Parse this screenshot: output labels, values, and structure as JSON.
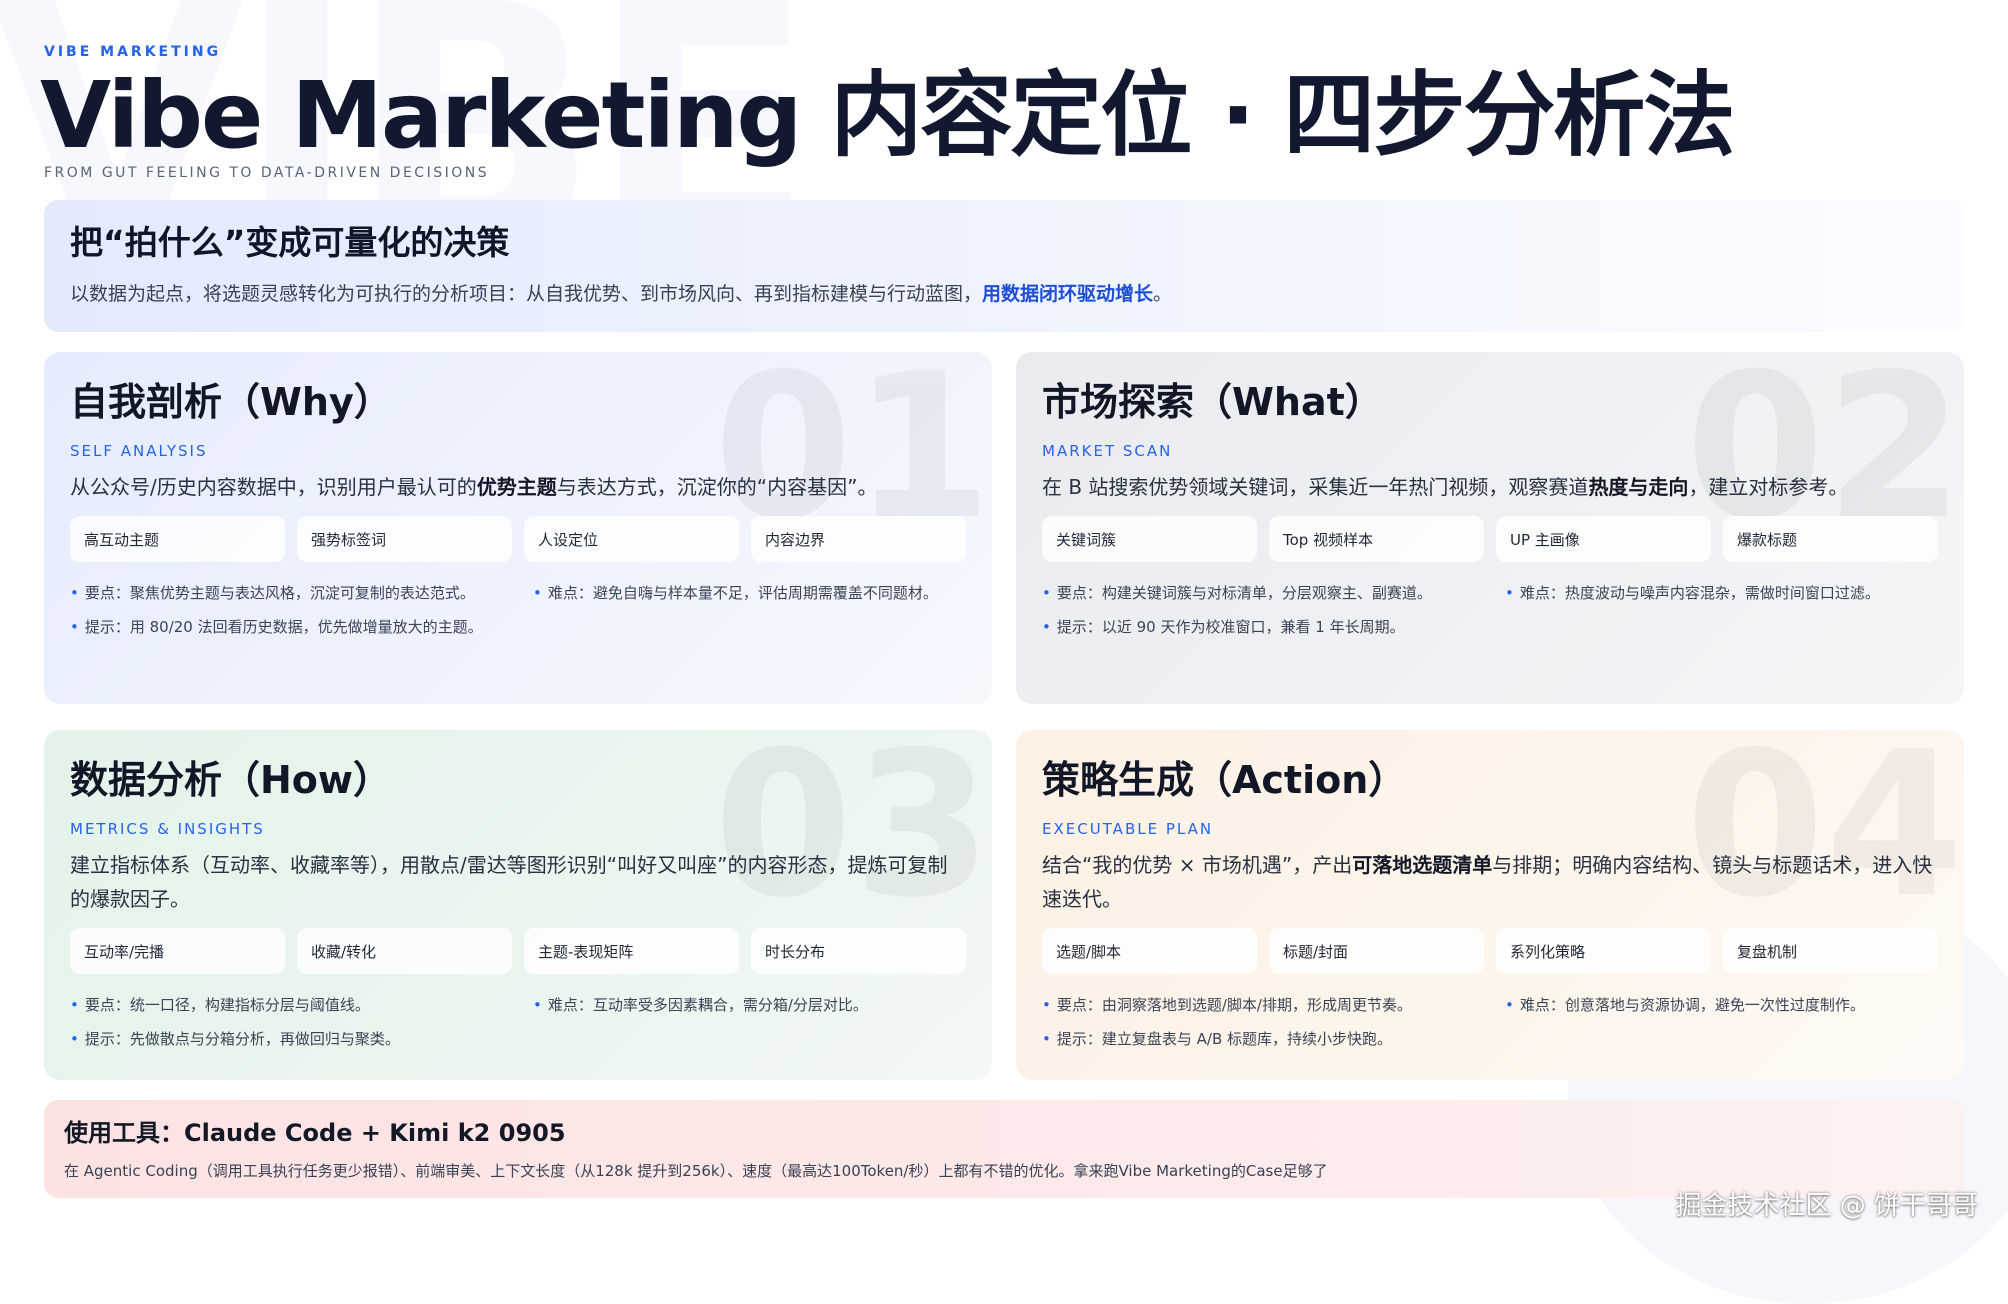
{
  "header": {
    "eyebrow": "VIBE MARKETING",
    "title": "Vibe Marketing 内容定位 · 四步分析法",
    "subtitle": "FROM GUT FEELING TO DATA-DRIVEN DECISIONS"
  },
  "intro": {
    "title": "把“拍什么”变成可量化的决策",
    "desc": "以数据为起点，将选题灵感转化为可执行的分析项目：从自我优势、到市场风向、再到指标建模与行动蓝图，",
    "highlight": "用数据闭环驱动增长",
    "end": "。"
  },
  "cards": [
    {
      "num": "01",
      "title": "自我剖析（Why）",
      "tag": "SELF ANALYSIS",
      "desc_a": "从公众号/历史内容数据中，识别用户最认可的",
      "desc_b": "优势主题",
      "desc_c": "与表达方式，沉淀你的“内容基因”。",
      "chips": [
        "高互动主题",
        "强势标签词",
        "人设定位",
        "内容边界"
      ],
      "notes": [
        "要点：聚焦优势主题与表达风格，沉淀可复制的表达范式。",
        "难点：避免自嗨与样本量不足，评估周期需覆盖不同题材。",
        "提示：用 80/20 法回看历史数据，优先做增量放大的主题。"
      ]
    },
    {
      "num": "02",
      "title": "市场探索（What）",
      "tag": "MARKET SCAN",
      "desc_a": "在 B 站搜索优势领域关键词，采集近一年热门视频，观察赛道",
      "desc_b": "热度与走向",
      "desc_c": "，建立对标参考。",
      "chips": [
        "关键词簇",
        "Top 视频样本",
        "UP 主画像",
        "爆款标题"
      ],
      "notes": [
        "要点：构建关键词簇与对标清单，分层观察主、副赛道。",
        "难点：热度波动与噪声内容混杂，需做时间窗口过滤。",
        "提示：以近 90 天作为校准窗口，兼看 1 年长周期。"
      ]
    },
    {
      "num": "03",
      "title": "数据分析（How）",
      "tag": "METRICS & INSIGHTS",
      "desc_a": "建立指标体系（互动率、收藏率等），用散点/雷达等图形识别“叫好又叫座”的内容形态，提炼可复制的爆款因子。",
      "desc_b": "",
      "desc_c": "",
      "chips": [
        "互动率/完播",
        "收藏/转化",
        "主题-表现矩阵",
        "时长分布"
      ],
      "notes": [
        "要点：统一口径，构建指标分层与阈值线。",
        "难点：互动率受多因素耦合，需分箱/分层对比。",
        "提示：先做散点与分箱分析，再做回归与聚类。"
      ]
    },
    {
      "num": "04",
      "title": "策略生成（Action）",
      "tag": "EXECUTABLE PLAN",
      "desc_a": "结合“我的优势 × 市场机遇”，产出",
      "desc_b": "可落地选题清单",
      "desc_c": "与排期；明确内容结构、镜头与标题话术，进入快速迭代。",
      "chips": [
        "选题/脚本",
        "标题/封面",
        "系列化策略",
        "复盘机制"
      ],
      "notes": [
        "要点：由洞察落地到选题/脚本/排期，形成周更节奏。",
        "难点：创意落地与资源协调，避免一次性过度制作。",
        "提示：建立复盘表与 A/B 标题库，持续小步快跑。"
      ]
    }
  ],
  "tools": {
    "title": "使用工具：Claude Code + Kimi k2 0905",
    "desc": "在 Agentic Coding（调用工具执行任务更少报错）、前端审美、上下文长度（从128k 提升到256k）、速度（最高达100Token/秒）上都有不错的优化。拿来跑Vibe Marketing的Case足够了"
  },
  "watermark": "掘金技术社区 @ 饼干哥哥"
}
